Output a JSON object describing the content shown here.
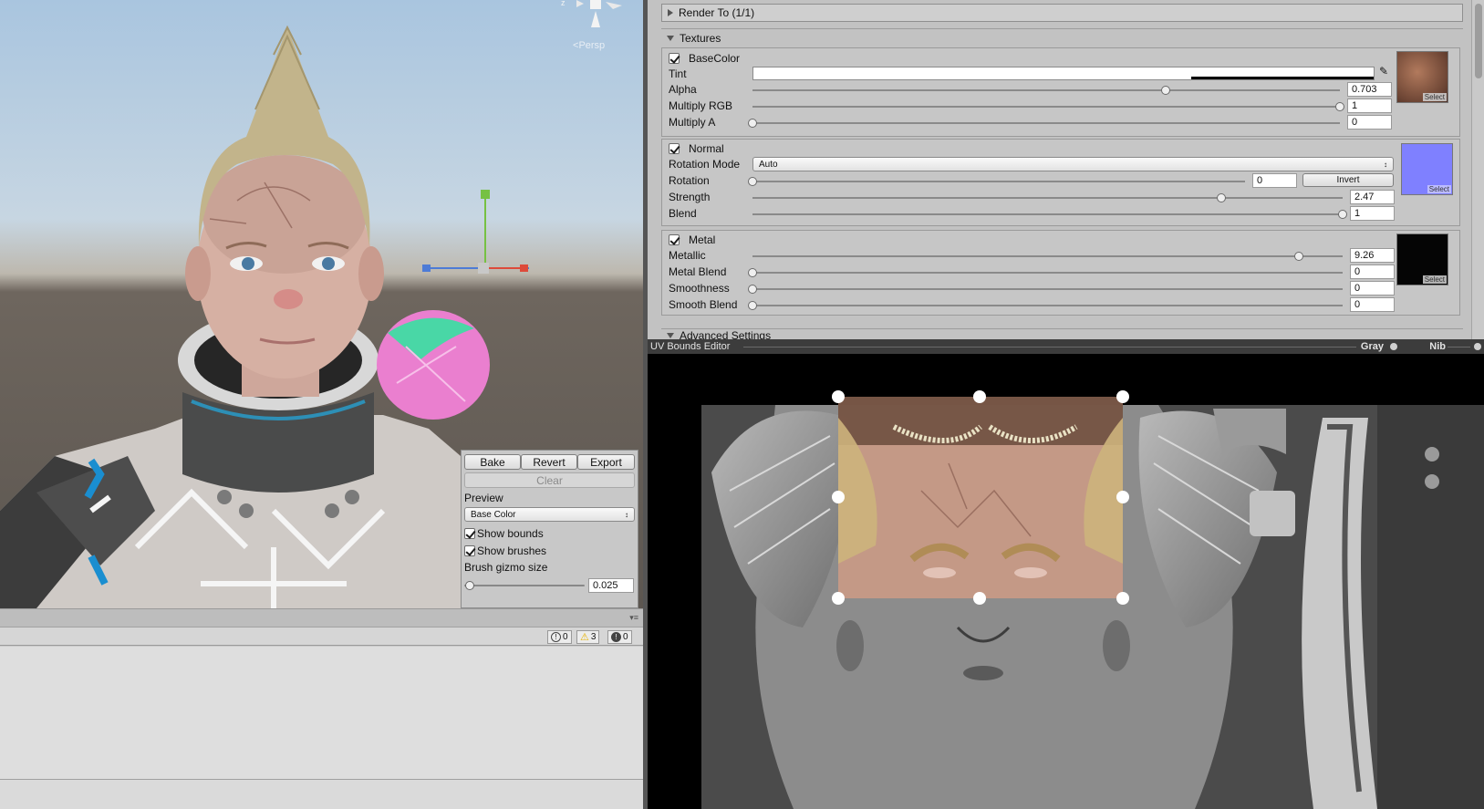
{
  "scene": {
    "camera_label": "Persp",
    "axis_label": "z",
    "bake_panel": {
      "bake_label": "Bake",
      "revert_label": "Revert",
      "export_label": "Export",
      "clear_label": "Clear",
      "preview_label": "Preview",
      "preview_value": "Base Color",
      "show_bounds_label": "Show bounds",
      "show_bounds_checked": true,
      "show_brushes_label": "Show brushes",
      "show_brushes_checked": true,
      "brush_gizmo_label": "Brush gizmo size",
      "brush_gizmo_value": "0.025",
      "brush_gizmo_fraction": 0.0
    }
  },
  "console": {
    "errors": "0",
    "warnings": "3",
    "messages": "0"
  },
  "inspector": {
    "render_to_label": "Render To (1/1)",
    "textures_label": "Textures",
    "advanced_label": "Advanced Settings",
    "basecolor": {
      "label": "BaseColor",
      "enabled": true,
      "tint_label": "Tint",
      "alpha_label": "Alpha",
      "alpha_value": "0.703",
      "alpha_fraction": 0.703,
      "multiply_rgb_label": "Multiply RGB",
      "multiply_rgb_value": "1",
      "multiply_a_label": "Multiply A",
      "multiply_a_value": "0",
      "select_label": "Select"
    },
    "normal": {
      "label": "Normal",
      "enabled": true,
      "rotation_mode_label": "Rotation Mode",
      "rotation_mode_value": "Auto",
      "rotation_label": "Rotation",
      "rotation_value": "0",
      "invert_label": "Invert",
      "strength_label": "Strength",
      "strength_value": "2.47",
      "blend_label": "Blend",
      "blend_value": "1",
      "select_label": "Select"
    },
    "metal": {
      "label": "Metal",
      "enabled": true,
      "metallic_label": "Metallic",
      "metallic_value": "9.26",
      "metal_blend_label": "Metal Blend",
      "metal_blend_value": "0",
      "smoothness_label": "Smoothness",
      "smoothness_value": "0",
      "smooth_blend_label": "Smooth Blend",
      "smooth_blend_value": "0",
      "select_label": "Select"
    }
  },
  "uv_editor": {
    "title": "UV Bounds Editor",
    "gray_label": "Gray",
    "nib_label": "Nib"
  },
  "colors": {
    "panel_bg": "#c2c2c2",
    "uv_header_bg": "#3c3c3c",
    "normal_map": "#7f80ff",
    "bounds_handle": "#ffffff"
  }
}
